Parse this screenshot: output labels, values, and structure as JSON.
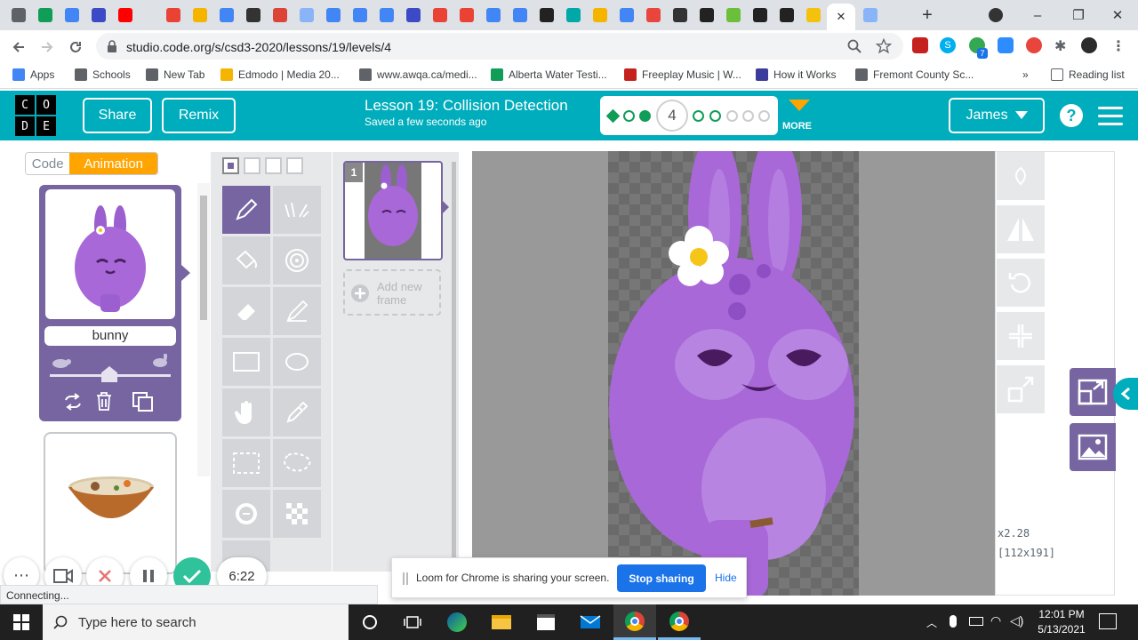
{
  "browser": {
    "url": "studio.code.org/s/csd3-2020/lessons/19/levels/4",
    "window_controls": {
      "minimize": "–",
      "restore": "❐",
      "close": "✕"
    },
    "new_tab_glyph": "+",
    "ext_badge": "7"
  },
  "bookmarks": [
    {
      "label": "Apps",
      "color": "#4285f4"
    },
    {
      "label": "Schools",
      "color": "#5f6368"
    },
    {
      "label": "New Tab",
      "color": "#5f6368"
    },
    {
      "label": "Edmodo | Media 20...",
      "color": "#f4b400"
    },
    {
      "label": "www.awqa.ca/medi...",
      "color": "#5f6368"
    },
    {
      "label": "Alberta Water Testi...",
      "color": "#0f9d58"
    },
    {
      "label": "Freeplay Music | W...",
      "color": "#c5221f"
    },
    {
      "label": "How it Works",
      "color": "#3c3c9c"
    },
    {
      "label": "Fremont County Sc...",
      "color": "#5f6368"
    }
  ],
  "bookmarks_overflow": "»",
  "reading_list": "Reading list",
  "header": {
    "logo_letters": [
      "C",
      "O",
      "D",
      "E"
    ],
    "share_label": "Share",
    "remix_label": "Remix",
    "lesson_title": "Lesson 19: Collision Detection",
    "saved_status": "Saved a few seconds ago",
    "current_level": "4",
    "more_label": "MORE",
    "user_name": "James",
    "help_glyph": "?",
    "accent_color": "#00adbc"
  },
  "mode_toggle": {
    "code_label": "Code",
    "animation_label": "Animation",
    "active_color": "#ffa400"
  },
  "sprite_list": {
    "selected_name": "bunny",
    "card_color": "#7665a0"
  },
  "frames": {
    "frame_number": "1",
    "add_line1": "Add new",
    "add_line2": "frame"
  },
  "canvas_info": {
    "zoom": "x2.28",
    "size": "[112x191]"
  },
  "bottom_controls": {
    "timer": "6:22",
    "more_glyph": "⋯"
  },
  "loom": {
    "message": "Loom for Chrome is sharing your screen.",
    "stop_label": "Stop sharing",
    "hide_label": "Hide"
  },
  "status_text": "Connecting...",
  "taskbar": {
    "search_placeholder": "Type here to search",
    "time": "12:01 PM",
    "date": "5/13/2021"
  }
}
